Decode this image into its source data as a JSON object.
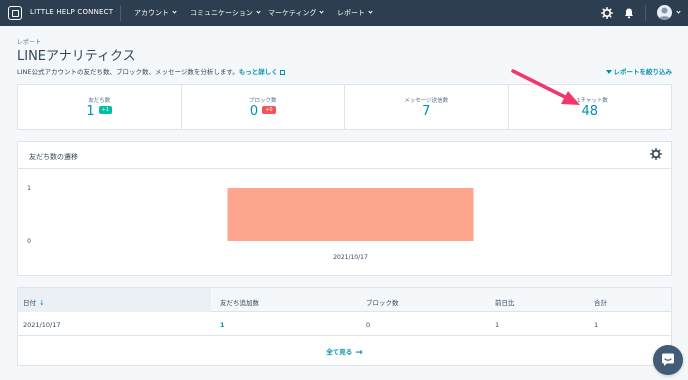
{
  "nav": {
    "brand": "LITTLE HELP CONNECT",
    "items": [
      {
        "label": "アカウント"
      },
      {
        "label": "コミュニケーション"
      },
      {
        "label": "マーケティング"
      },
      {
        "label": "レポート"
      }
    ],
    "icons": [
      "gear-icon",
      "bell-icon",
      "avatar"
    ]
  },
  "header": {
    "breadcrumb": "レポート",
    "title": "LINEアナリティクス",
    "subtitle": "LINE公式アカウントの友だち数、ブロック数、メッセージ数を分析します。",
    "more_link": "もっと詳しく",
    "filter_link": "レポートを絞り込み"
  },
  "stats": [
    {
      "label": "友だち数",
      "value": "1",
      "badge": "+1",
      "badge_type": "up"
    },
    {
      "label": "ブロック数",
      "value": "0",
      "badge": "+0",
      "badge_type": "down"
    },
    {
      "label": "メッセージ送信数",
      "value": "7"
    },
    {
      "label": "1:1チャット数",
      "value": "48"
    }
  ],
  "chart": {
    "title": "友だち数の遷移",
    "bar_color": "#fea58e"
  },
  "chart_data": {
    "type": "bar",
    "categories": [
      "2021/10/17"
    ],
    "values": [
      1
    ],
    "ylim": [
      0,
      1
    ],
    "yticks": [
      "0",
      "1"
    ],
    "grid": false
  },
  "table": {
    "headers": [
      "日付",
      "友だち追加数",
      "ブロック数",
      "前日比",
      "合計"
    ],
    "rows": [
      [
        "2021/10/17",
        "1",
        "0",
        "1",
        "1"
      ]
    ],
    "see_all": "全て見る"
  },
  "colors": {
    "nav_bg": "#2d3e50",
    "accent": "#0091ae",
    "annotation": "#f0386b"
  }
}
